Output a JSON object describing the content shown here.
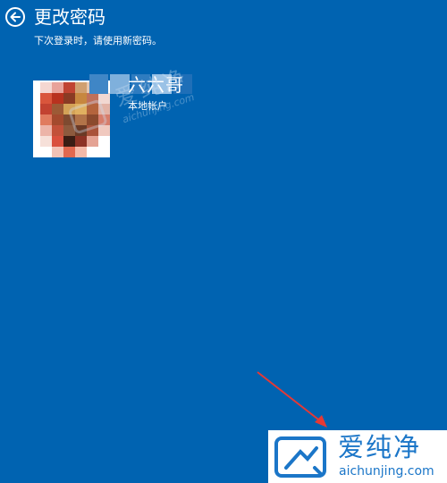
{
  "header": {
    "title": "更改密码",
    "subtitle": "下次登录时，请使用新密码。"
  },
  "account": {
    "name": "六六哥",
    "type": "本地帐户"
  },
  "watermark": {
    "cn": "爱纯净",
    "en": "aichunjing.com"
  },
  "colors": {
    "background": "#0063b1",
    "text": "#ffffff",
    "logo_blue": "#1b76c8",
    "arrow_red": "#e53935"
  },
  "icons": {
    "back": "back-arrow-circle-icon",
    "logo": "aichunjing-logo-icon"
  }
}
